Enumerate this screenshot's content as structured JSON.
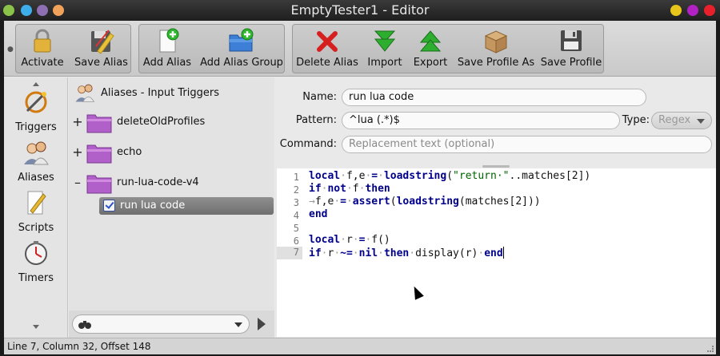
{
  "window": {
    "title": "EmptyTester1 - Editor"
  },
  "toolbar": {
    "activate": "Activate",
    "save_alias": "Save Alias",
    "add_alias": "Add Alias",
    "add_alias_group": "Add Alias Group",
    "delete_alias": "Delete Alias",
    "import": "Import",
    "export": "Export",
    "save_profile_as": "Save Profile As",
    "save_profile": "Save Profile"
  },
  "sidebar": {
    "items": [
      {
        "label": "Triggers",
        "icon": "triggers-icon"
      },
      {
        "label": "Aliases",
        "icon": "aliases-icon"
      },
      {
        "label": "Scripts",
        "icon": "scripts-icon"
      },
      {
        "label": "Timers",
        "icon": "timers-icon"
      }
    ]
  },
  "tree": {
    "header": "Aliases - Input Triggers",
    "folders": [
      {
        "label": "deleteOldProfiles",
        "expander": "+"
      },
      {
        "label": "echo",
        "expander": "+"
      },
      {
        "label": "run-lua-code-v4",
        "expander": "–"
      }
    ],
    "selected_item": "run lua code"
  },
  "form": {
    "name_label": "Name:",
    "name_value": "run lua code",
    "pattern_label": "Pattern:",
    "pattern_value": "^lua (.*)$",
    "type_label": "Type:",
    "type_value": "Regex",
    "command_label": "Command:",
    "command_placeholder": "Replacement text (optional)"
  },
  "editor": {
    "line_numbers": [
      "1",
      "2",
      "3",
      "4",
      "5",
      "6",
      "7"
    ],
    "current_line": 7
  },
  "status": {
    "text": "Line 7, Column 32, Offset 148"
  },
  "colors": {
    "keyword": "#00008b",
    "string": "#006400",
    "titlebar": "#2a2a2a"
  }
}
